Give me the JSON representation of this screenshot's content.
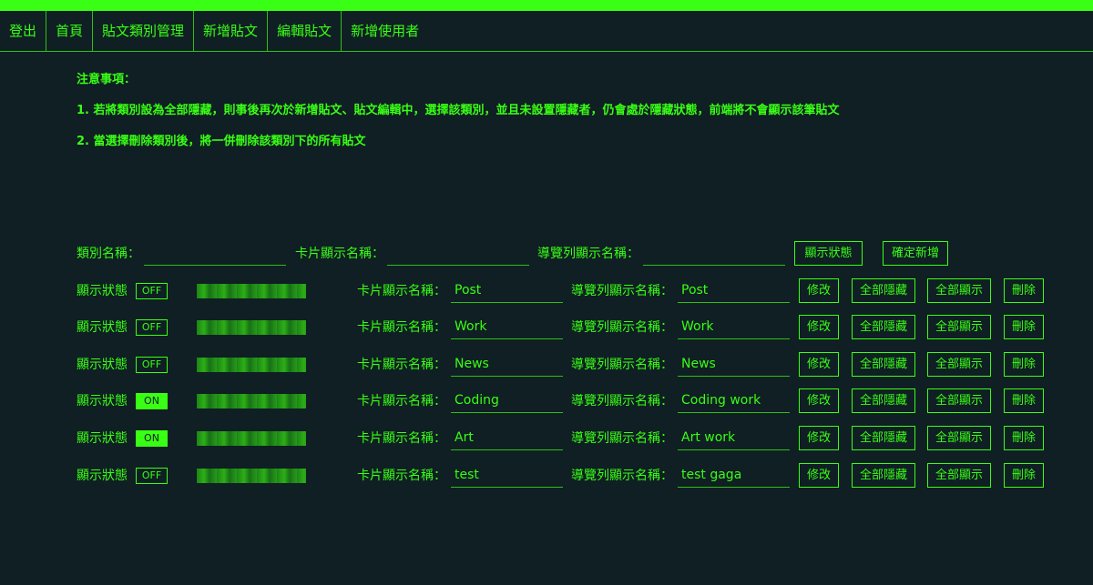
{
  "nav": {
    "items": [
      "登出",
      "首頁",
      "貼文類別管理",
      "新增貼文",
      "編輯貼文",
      "新增使用者"
    ]
  },
  "notes": {
    "title": "注意事項：",
    "item1": "1. 若將類別設為全部隱藏，則事後再次於新增貼文、貼文編輯中，選擇該類別，並且未設置隱藏者，仍會處於隱藏狀態，前端將不會顯示該筆貼文",
    "item2": "2. 當選擇刪除類別後，將一併刪除該類別下的所有貼文"
  },
  "add_form": {
    "category_label": "類別名稱：",
    "card_label": "卡片顯示名稱：",
    "nav_label": "導覽列顯示名稱：",
    "status_button": "顯示狀態",
    "confirm_button": "確定新增"
  },
  "row_labels": {
    "status": "顯示狀態",
    "card": "卡片顯示名稱：",
    "nav": "導覽列顯示名稱：",
    "edit": "修改",
    "hide_all": "全部隱藏",
    "show_all": "全部顯示",
    "delete": "刪除"
  },
  "categories": [
    {
      "toggle": "OFF",
      "card_name": "Post",
      "nav_name": "Post"
    },
    {
      "toggle": "OFF",
      "card_name": "Work",
      "nav_name": "Work"
    },
    {
      "toggle": "OFF",
      "card_name": "News",
      "nav_name": "News"
    },
    {
      "toggle": "ON",
      "card_name": "Coding",
      "nav_name": "Coding work"
    },
    {
      "toggle": "ON",
      "card_name": "Art",
      "nav_name": "Art work"
    },
    {
      "toggle": "OFF",
      "card_name": "test",
      "nav_name": "test gaga"
    }
  ],
  "colors": {
    "accent": "#39ff14",
    "background": "#0f1f23"
  }
}
